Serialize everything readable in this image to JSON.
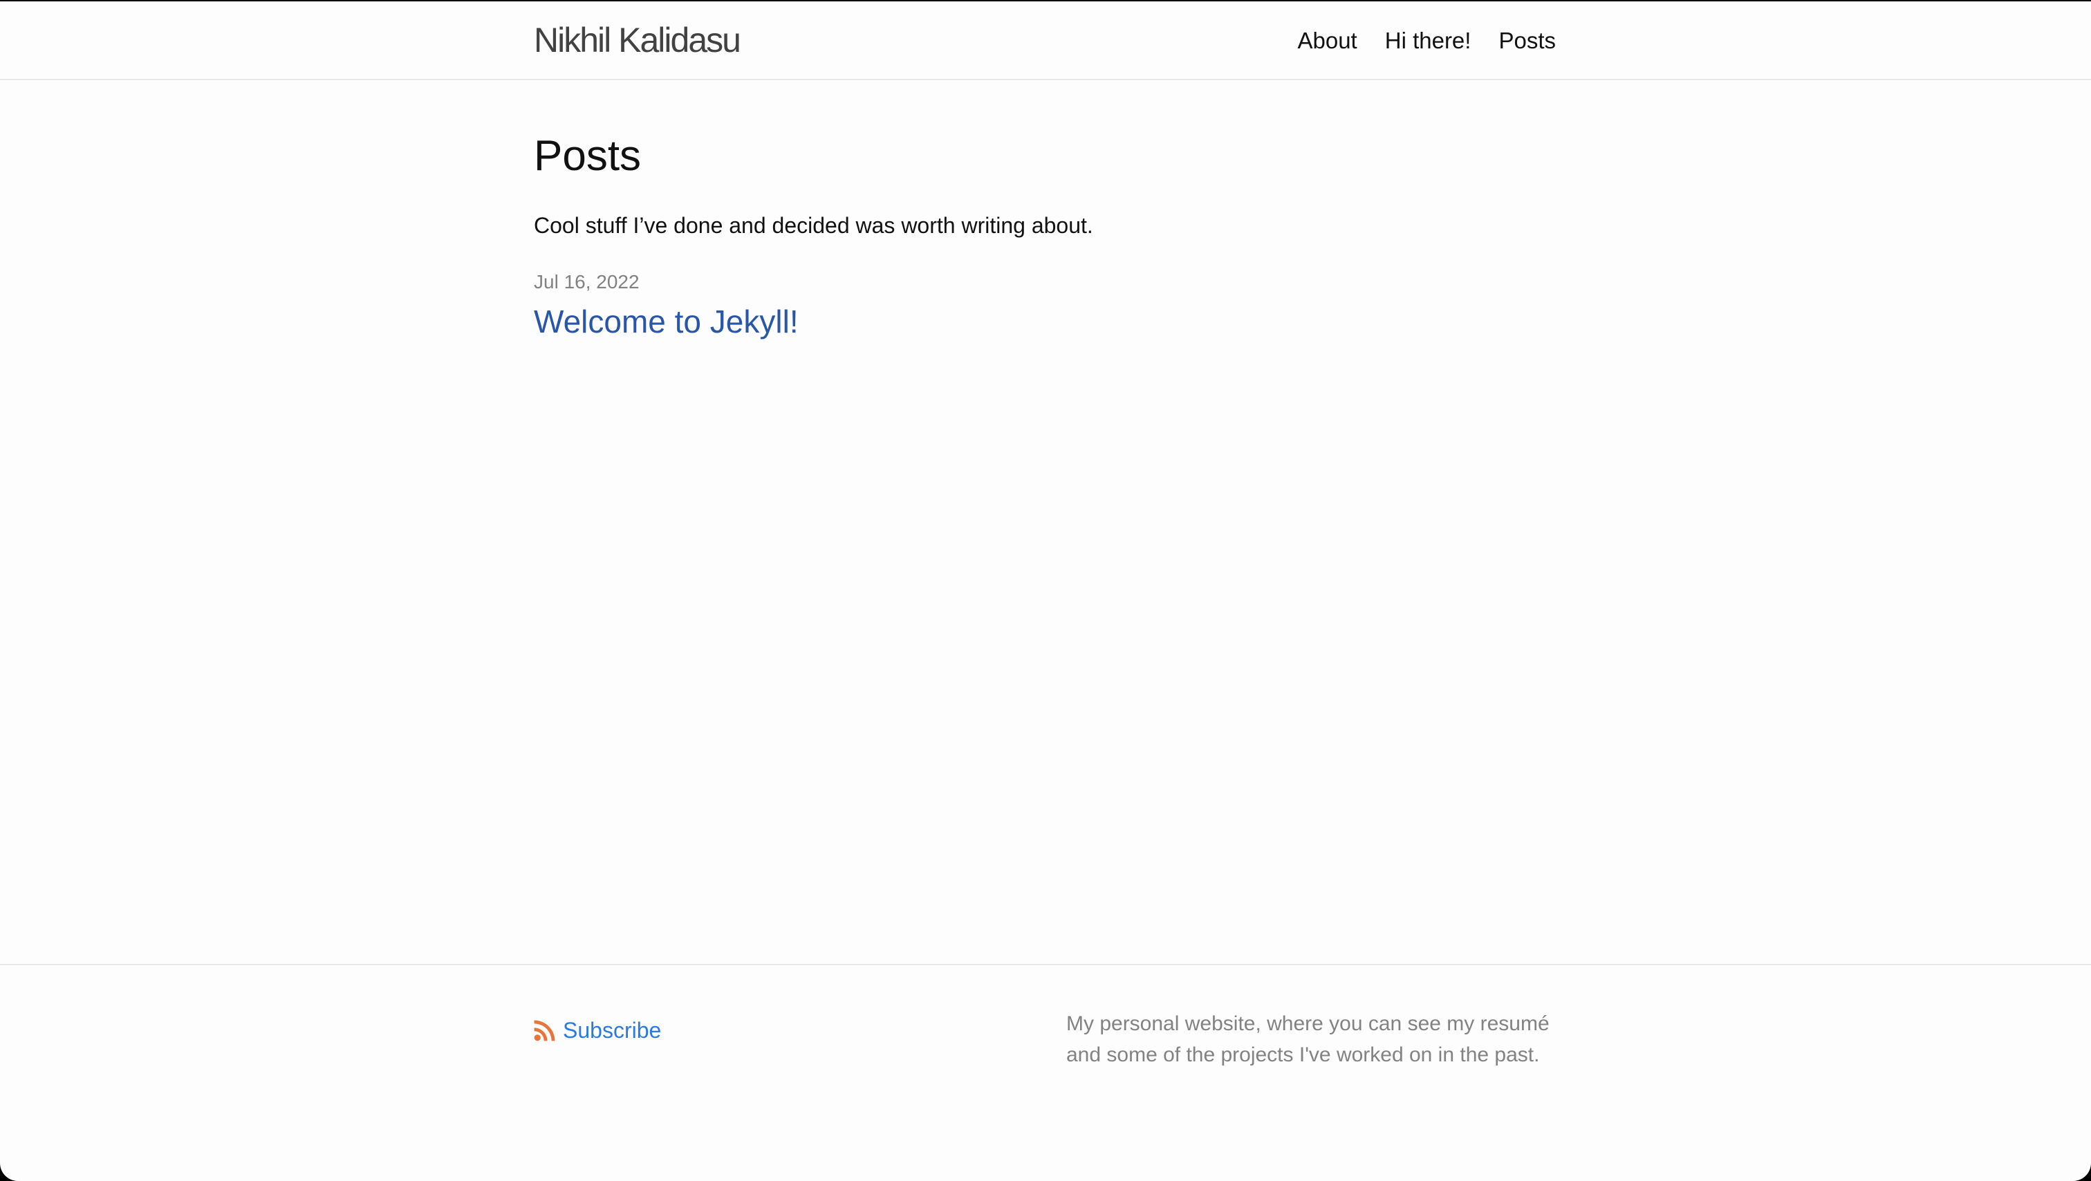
{
  "header": {
    "site_title": "Nikhil Kalidasu",
    "nav": [
      {
        "label": "About"
      },
      {
        "label": "Hi there!"
      },
      {
        "label": "Posts"
      }
    ]
  },
  "main": {
    "heading": "Posts",
    "intro": "Cool stuff I’ve done and decided was worth writing about.",
    "posts": [
      {
        "date": "Jul 16, 2022",
        "title": "Welcome to Jekyll!"
      }
    ]
  },
  "footer": {
    "subscribe_label": "Subscribe",
    "subscribe_icon": "rss-icon",
    "description": "My personal website, where you can see my resumé and some of the projects I've worked on in the past."
  },
  "colors": {
    "link": "#2a56a8",
    "subscribe_link": "#2a7ae2",
    "rss_icon": "#e8743b",
    "muted_text": "#828282",
    "border": "#e8e8e8",
    "background": "#fdfdfd"
  }
}
